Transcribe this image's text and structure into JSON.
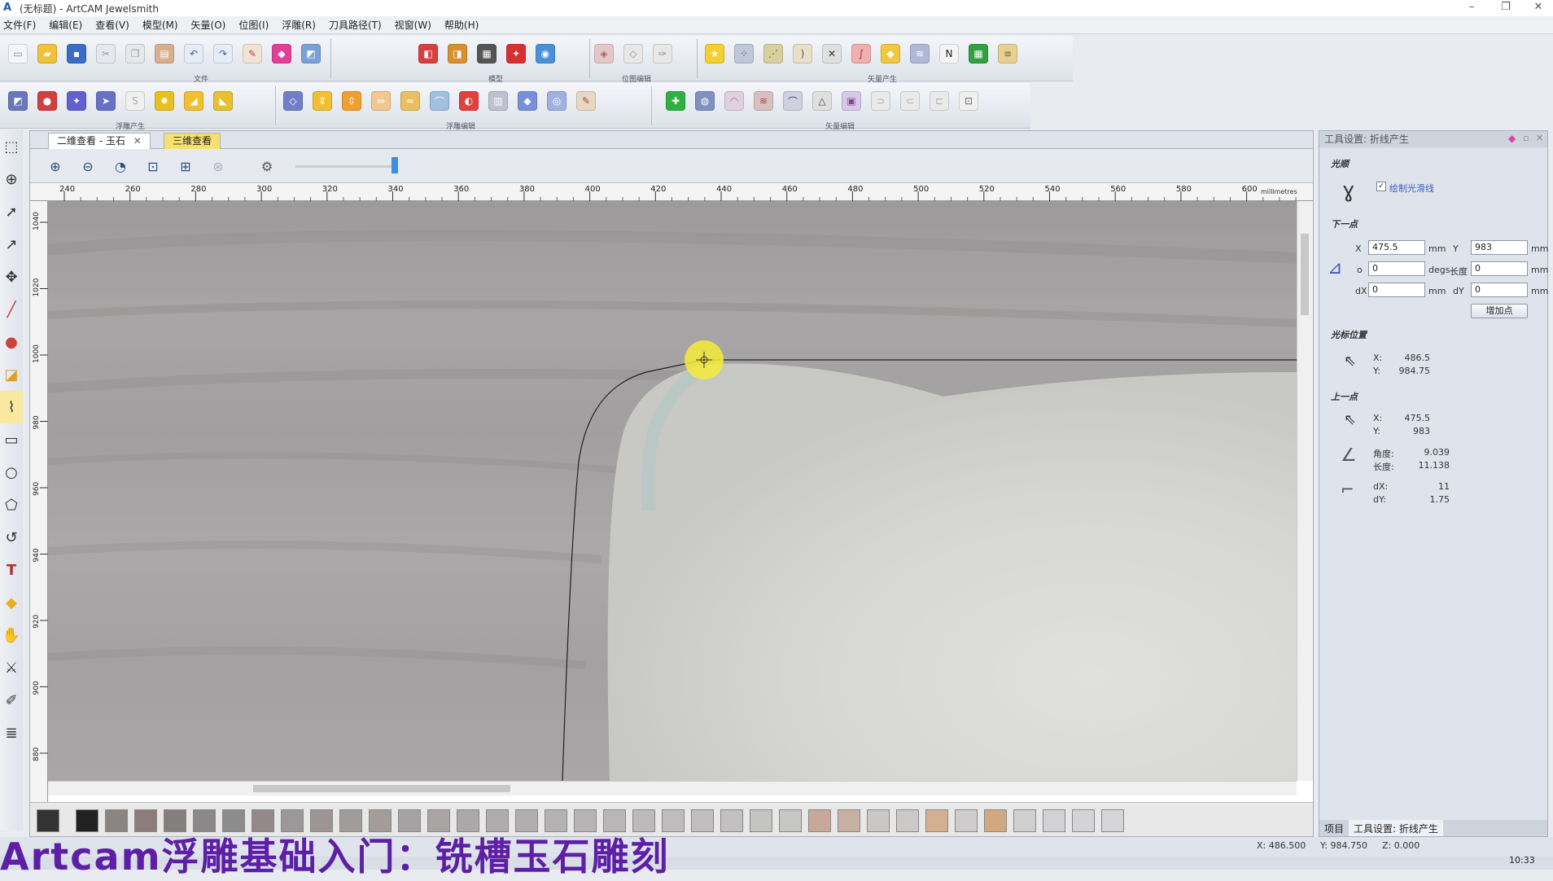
{
  "window": {
    "title": "(无标题) - ArtCAM Jewelsmith",
    "app_icon": "artcam-icon",
    "minimize": "–",
    "restore": "❐",
    "close": "✕"
  },
  "menu": [
    "文件(F)",
    "编辑(E)",
    "查看(V)",
    "模型(M)",
    "矢量(O)",
    "位图(I)",
    "浮雕(R)",
    "刀具路径(T)",
    "视窗(W)",
    "帮助(H)"
  ],
  "toolbar_groups": {
    "g1": "文件",
    "g2": "模型",
    "g3": "位图编辑",
    "g4": "矢量产生",
    "g5": "浮雕产生",
    "g6": "浮雕编辑",
    "g7": "矢量编辑"
  },
  "view": {
    "tab_2d": "二维查看 - 玉石",
    "tab_3d": "三维查看",
    "units": "millimetres",
    "ruler_x": [
      "240",
      "260",
      "280",
      "300",
      "320",
      "340",
      "360",
      "380",
      "400",
      "420",
      "440",
      "460",
      "480",
      "500",
      "520",
      "540",
      "560",
      "580",
      "600"
    ],
    "ruler_y": [
      "1040",
      "1020",
      "1000",
      "980",
      "960",
      "940",
      "920",
      "900",
      "880"
    ]
  },
  "panel": {
    "title": "工具设置: 折线产生",
    "smooth_section": "光顺",
    "smooth_checkbox_label": "绘制光滑线",
    "next_point_section": "下一点",
    "x_label": "X",
    "x_value": "475.5",
    "x_unit": "mm",
    "y_label": "Y",
    "y_value": "983",
    "y_unit": "mm",
    "angle_label": "o",
    "angle_value": "0",
    "angle_unit": "degs",
    "length_label": "长度",
    "length_value": "0",
    "length_unit": "mm",
    "dx_label": "dX",
    "dx_value": "0",
    "dx_unit": "mm",
    "dy_label": "dY",
    "dy_value": "0",
    "dy_unit": "mm",
    "add_point_button": "增加点",
    "cursor_section": "光标位置",
    "cursor_x_label": "X:",
    "cursor_x": "486.5",
    "cursor_y_label": "Y:",
    "cursor_y": "984.75",
    "prev_point_section": "上一点",
    "prev_x_label": "X:",
    "prev_x": "475.5",
    "prev_y_label": "Y:",
    "prev_y": "983",
    "angle2_label": "角度:",
    "angle2": "9.039",
    "length2_label": "长度:",
    "length2": "11.138",
    "dx2_label": "dX:",
    "dx2": "11",
    "dy2_label": "dY:",
    "dy2": "1.75",
    "tab_project": "项目",
    "tab_tools": "工具设置: 折线产生"
  },
  "status": {
    "x": "X: 486.500",
    "y": "Y: 984.750",
    "z": "Z: 0.000",
    "time": "10:33"
  },
  "overlay_caption": "Artcam浮雕基础入门：铣槽玉石雕刻"
}
